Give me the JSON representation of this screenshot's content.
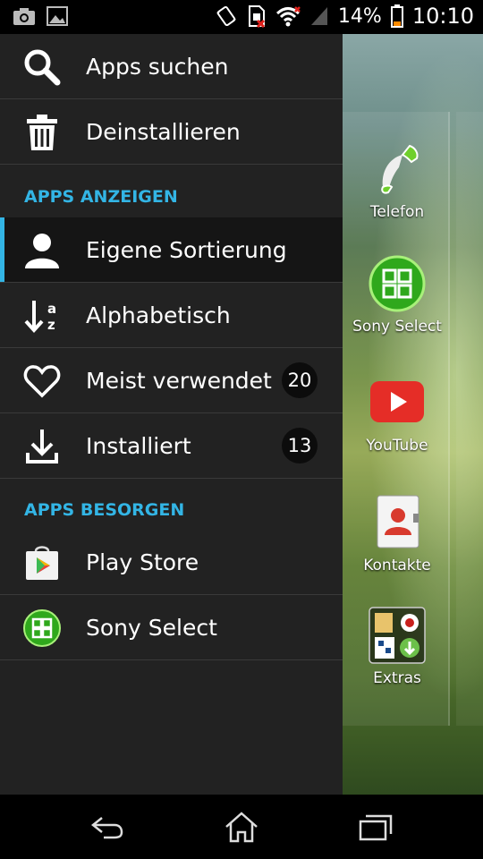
{
  "status_bar": {
    "battery_percent": "14%",
    "time": "10:10",
    "icons": [
      "camera-icon",
      "image-icon",
      "vibrate-icon",
      "sim-missing-icon",
      "wifi-icon",
      "signal-icon",
      "battery-icon"
    ]
  },
  "drawer": {
    "top_items": [
      {
        "label": "Apps suchen",
        "icon": "search-icon"
      },
      {
        "label": "Deinstallieren",
        "icon": "trash-icon"
      }
    ],
    "section_show": "APPS ANZEIGEN",
    "sort_items": [
      {
        "label": "Eigene Sortierung",
        "icon": "person-icon",
        "active": true
      },
      {
        "label": "Alphabetisch",
        "icon": "alphabetical-sort-icon"
      },
      {
        "label": "Meist verwendet",
        "icon": "heart-icon",
        "badge": "20"
      },
      {
        "label": "Installiert",
        "icon": "download-icon",
        "badge": "13"
      }
    ],
    "section_get": "APPS BESORGEN",
    "get_items": [
      {
        "label": "Play Store",
        "icon": "play-store-icon"
      },
      {
        "label": "Sony Select",
        "icon": "sony-select-icon"
      }
    ]
  },
  "home_apps": [
    {
      "label": "Telefon",
      "icon": "phone-icon"
    },
    {
      "label": "Sony Select",
      "icon": "sony-select-icon"
    },
    {
      "label": "YouTube",
      "icon": "youtube-icon"
    },
    {
      "label": "Kontakte",
      "icon": "contacts-icon"
    },
    {
      "label": "Extras",
      "icon": "extras-folder-icon"
    }
  ],
  "nav_bar": {
    "buttons": [
      "back-icon",
      "home-icon",
      "recents-icon"
    ]
  },
  "colors": {
    "accent": "#33b5e5",
    "drawer_bg": "#222222",
    "active_row_bg": "#151515"
  }
}
